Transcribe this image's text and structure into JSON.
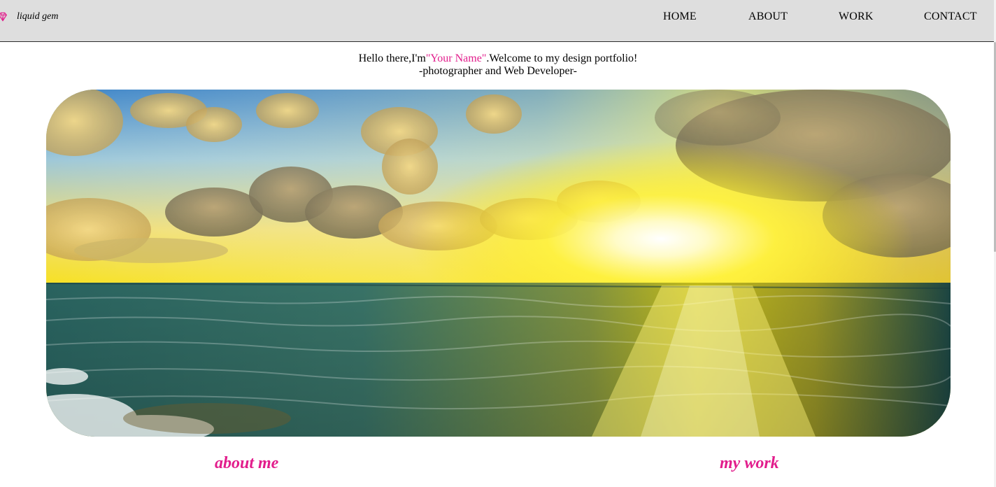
{
  "brand": {
    "name": "liquid gem",
    "icon": "gem-icon",
    "accent_color": "#e21d8c"
  },
  "nav": {
    "items": [
      {
        "label": "HOME"
      },
      {
        "label": "ABOUT"
      },
      {
        "label": "WORK"
      },
      {
        "label": "CONTACT"
      }
    ]
  },
  "intro": {
    "greeting_prefix": "Hello there,I'm",
    "name": "\"Your Name\"",
    "greeting_suffix": ".Welcome to my design portfolio!",
    "tagline": "-photographer and Web Developer-"
  },
  "hero": {
    "image": "sunset-over-ocean"
  },
  "sections": {
    "about_title": "about me",
    "work_title": "my work"
  },
  "colors": {
    "header_bg": "#dedede",
    "accent": "#e21d8c"
  }
}
